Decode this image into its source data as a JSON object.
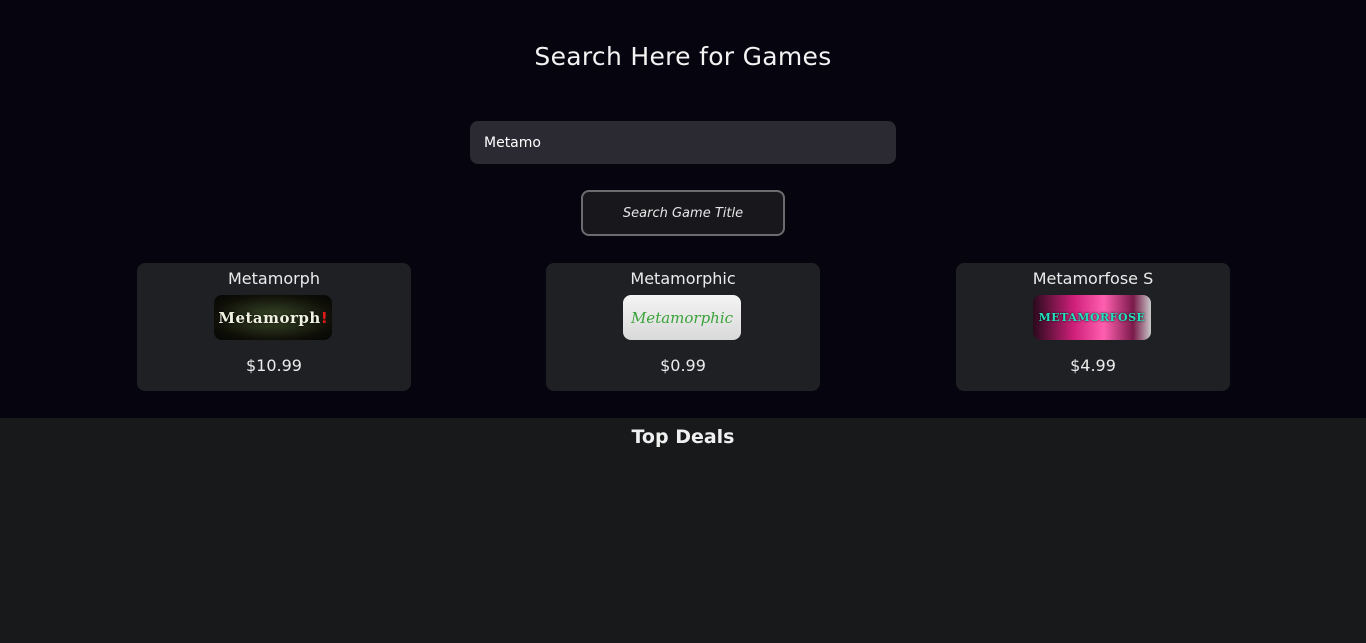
{
  "page": {
    "title": "Search Here for Games"
  },
  "search": {
    "value": "Metamo",
    "button_label": "Search Game Title"
  },
  "results": [
    {
      "name": "Metamorph",
      "thumb_text": "Metamorph",
      "thumb_accent": "!",
      "price": "$10.99"
    },
    {
      "name": "Metamorphic",
      "thumb_text": "Metamorphic",
      "price": "$0.99"
    },
    {
      "name": "Metamorfose S",
      "thumb_text": "METAMORFOSE",
      "price": "$4.99"
    }
  ],
  "deals": {
    "title": "Top Deals"
  },
  "colors": {
    "top_background": "#05040f",
    "bottom_background": "#18191b",
    "card_background": "#1f2023",
    "input_background": "#2b2a33"
  }
}
